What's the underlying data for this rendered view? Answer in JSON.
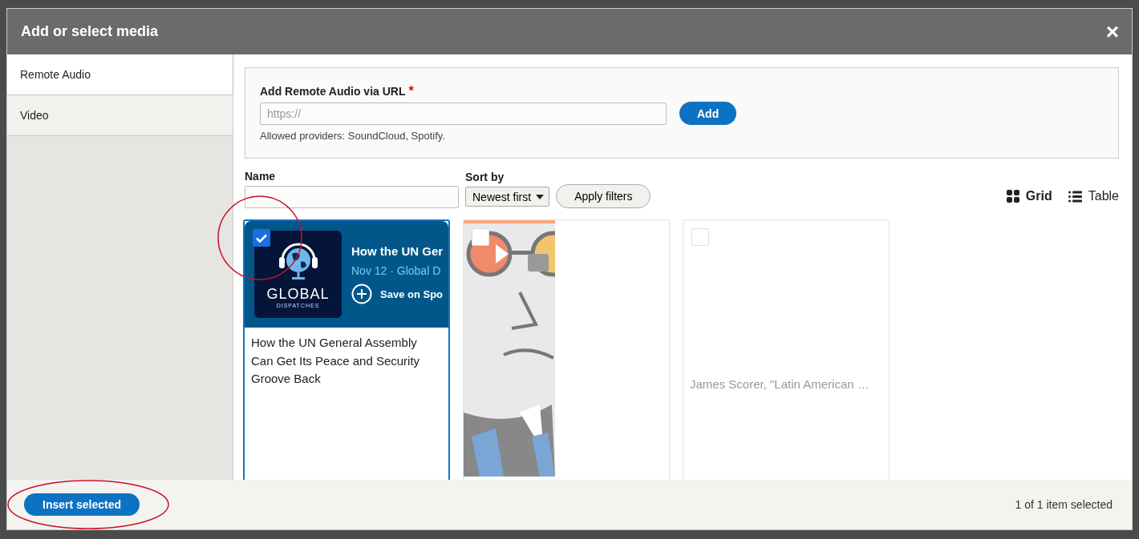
{
  "dialog": {
    "title": "Add or select media",
    "close": "×"
  },
  "tabs": [
    {
      "label": "Remote Audio",
      "selected": true
    },
    {
      "label": "Video",
      "selected": false
    }
  ],
  "url_form": {
    "label": "Add Remote Audio via URL",
    "required_mark": "*",
    "placeholder": "https://",
    "button": "Add",
    "hint": "Allowed providers: SoundCloud, Spotify."
  },
  "filters": {
    "name_label": "Name",
    "sort_label": "Sort by",
    "sort_value": "Newest first",
    "apply": "Apply filters"
  },
  "views": [
    {
      "label": "Grid",
      "selected": true
    },
    {
      "label": "Table",
      "selected": false
    }
  ],
  "media": [
    {
      "kind": "embed",
      "checked": true,
      "selected": true,
      "embed_title": "How the UN Ger",
      "embed_meta": "Nov 12 · Global D",
      "embed_save": "Save on Spo",
      "logo_top": "GLOBAL",
      "logo_sub": "DISPATCHES",
      "title": "How the UN General Assembly Can Get Its Peace and Security Groove Back"
    },
    {
      "kind": "picture",
      "checked": false,
      "selected": false
    },
    {
      "kind": "blank",
      "checked": false,
      "selected": false,
      "title": "James Scorer, \"Latin American …"
    }
  ],
  "footer": {
    "button": "Insert selected",
    "status": "1 of 1 item selected"
  }
}
